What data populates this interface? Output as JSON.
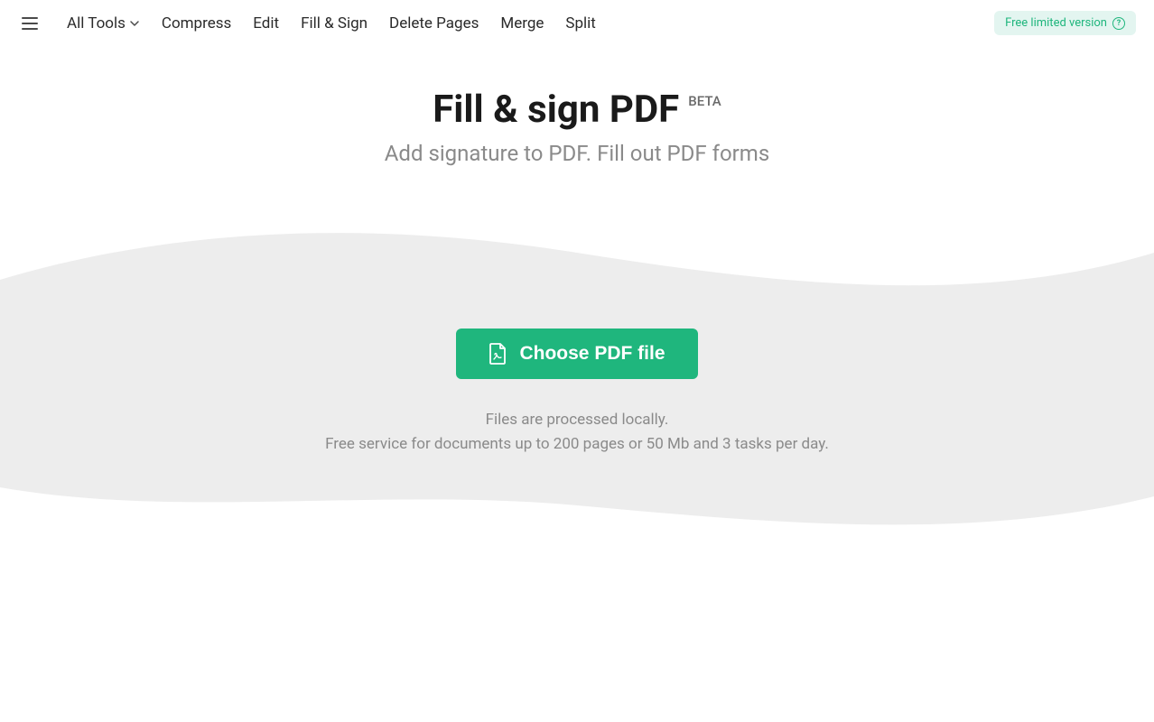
{
  "nav": {
    "all_tools": "All Tools",
    "items": [
      "Compress",
      "Edit",
      "Fill & Sign",
      "Delete Pages",
      "Merge",
      "Split"
    ]
  },
  "badge": {
    "text": "Free limited version"
  },
  "hero": {
    "title": "Fill & sign PDF",
    "beta": "BETA",
    "subtitle": "Add signature to PDF. Fill out PDF forms"
  },
  "upload": {
    "button_label": "Choose PDF file",
    "info_line1": "Files are processed locally.",
    "info_line2": "Free service for documents up to 200 pages or 50 Mb and 3 tasks per day."
  },
  "colors": {
    "accent": "#1fb67d",
    "badge_bg": "#e3f5f0",
    "wave_bg": "#ededed"
  }
}
